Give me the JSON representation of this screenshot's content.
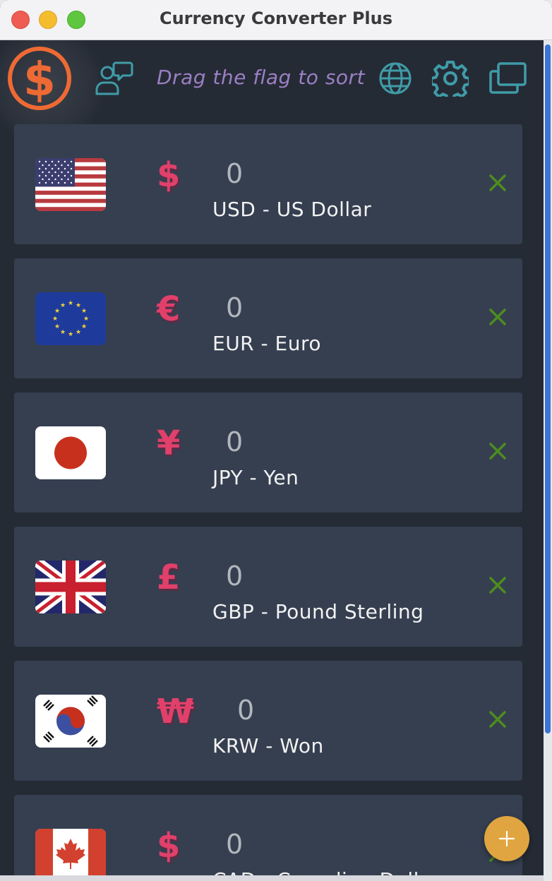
{
  "window": {
    "title": "Currency Converter Plus"
  },
  "toolbar": {
    "hint": "Drag the flag to sort"
  },
  "colors": {
    "accent": "#3f9ca8",
    "logo": "#ee6a34",
    "symbol": "#e0406a",
    "remove": "#4d8c1f",
    "fab": "#e0a540",
    "hint": "#9c7fc4"
  },
  "currencies": [
    {
      "code_name": "USD - US Dollar",
      "symbol": "$",
      "amount": "0",
      "flag": "us-flag"
    },
    {
      "code_name": "EUR - Euro",
      "symbol": "€",
      "amount": "0",
      "flag": "eu-flag"
    },
    {
      "code_name": "JPY - Yen",
      "symbol": "¥",
      "amount": "0",
      "flag": "jp-flag"
    },
    {
      "code_name": "GBP - Pound Sterling",
      "symbol": "£",
      "amount": "0",
      "flag": "gb-flag"
    },
    {
      "code_name": "KRW - Won",
      "symbol": "₩",
      "amount": "0",
      "flag": "kr-flag"
    },
    {
      "code_name": "CAD - Canadian Dollar",
      "symbol": "$",
      "amount": "0",
      "flag": "ca-flag"
    }
  ],
  "icons": {
    "logo": "dollar-logo-icon",
    "feedback": "chat-person-icon",
    "globe": "globe-icon",
    "settings": "gear-icon",
    "windows": "windows-icon",
    "remove": "close-icon",
    "add": "plus-icon"
  }
}
